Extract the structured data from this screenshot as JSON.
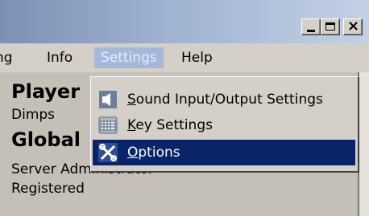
{
  "menubar": {
    "items": [
      {
        "label": "ng"
      },
      {
        "label": "Info"
      },
      {
        "label": "Settings"
      },
      {
        "label": "Help"
      }
    ]
  },
  "content": {
    "player_heading": "Player",
    "player_name": "Dimps",
    "global_heading": "Global",
    "role_line": "Server Administrator",
    "status_line": "Registered"
  },
  "settings_menu": {
    "items": [
      {
        "first": "S",
        "rest": "ound Input/Output Settings",
        "icon": "speaker-icon"
      },
      {
        "first": "K",
        "rest": "ey Settings",
        "icon": "keyboard-icon"
      },
      {
        "first": "O",
        "rest": "ptions",
        "icon": "tools-icon"
      }
    ]
  },
  "colors": {
    "menu_highlight": "#0a246a",
    "menubar_active": "#a5b8dc"
  }
}
